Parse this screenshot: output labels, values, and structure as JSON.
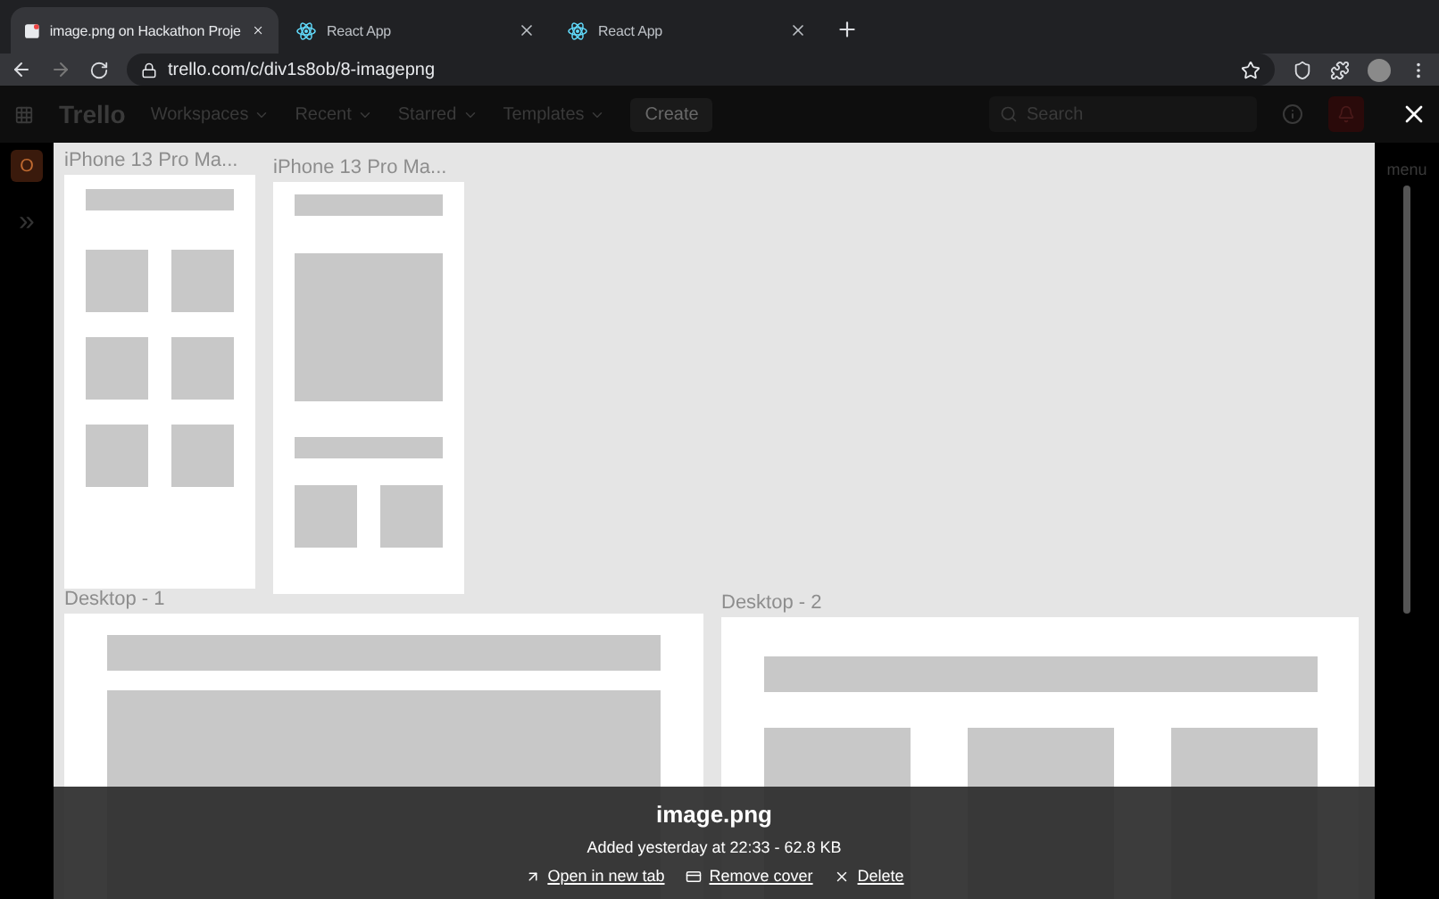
{
  "browser": {
    "tabs": [
      {
        "title": "image.png on Hackathon Proje",
        "selected": true,
        "kind": "trello"
      },
      {
        "title": "React App",
        "selected": false,
        "kind": "react"
      },
      {
        "title": "React App",
        "selected": false,
        "kind": "react"
      }
    ],
    "url": "trello.com/c/div1s8ob/8-imagepng"
  },
  "trello_header": {
    "logo": "Trello",
    "nav": [
      "Workspaces",
      "Recent",
      "Starred",
      "Templates"
    ],
    "create": "Create",
    "search_placeholder": "Search"
  },
  "sidebar": {
    "board_initial": "O",
    "expand": "»"
  },
  "behind_text": "menu",
  "viewer": {
    "frames": [
      {
        "label": "iPhone 13 Pro Ma...",
        "kind": "phone-grid"
      },
      {
        "label": "iPhone 13 Pro Ma...",
        "kind": "phone-detail"
      },
      {
        "label": "Desktop - 1",
        "kind": "desktop-single"
      },
      {
        "label": "Desktop - 2",
        "kind": "desktop-columns"
      }
    ],
    "caption": {
      "filename": "image.png",
      "meta": "Added yesterday at 22:33 - 62.8 KB",
      "actions": [
        {
          "label": "Open in new tab",
          "kind": "open"
        },
        {
          "label": "Remove cover",
          "kind": "cover"
        },
        {
          "label": "Delete",
          "kind": "delete"
        }
      ]
    }
  }
}
